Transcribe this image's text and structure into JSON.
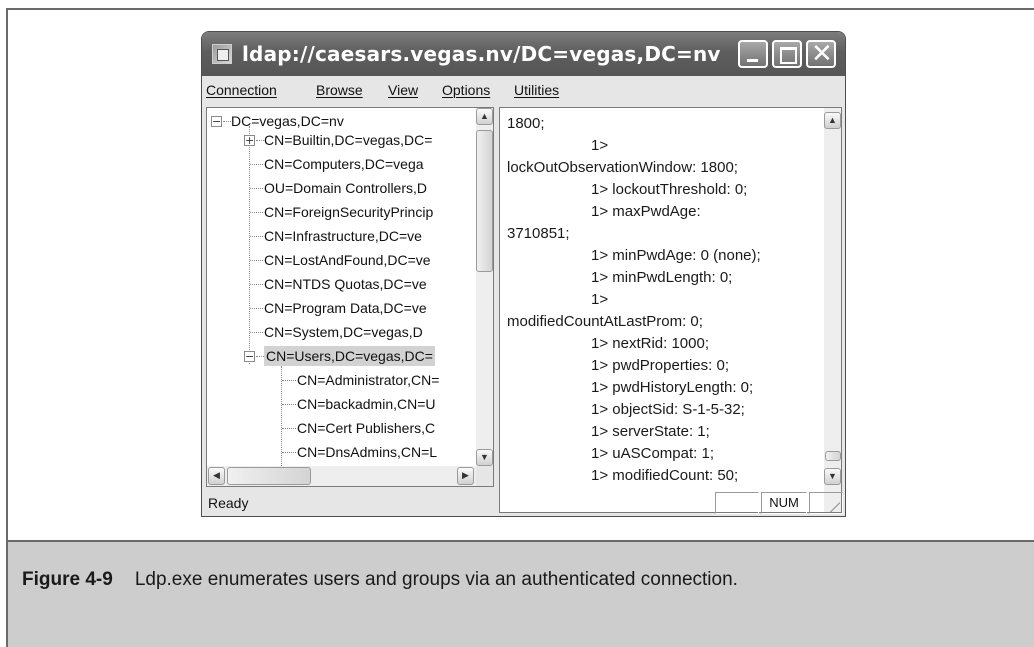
{
  "window": {
    "title": "ldap://caesars.vegas.nv/DC=vegas,DC=nv",
    "menu": [
      "Connection",
      "Browse",
      "View",
      "Options",
      "Utilities"
    ]
  },
  "tree": {
    "root": "DC=vegas,DC=nv",
    "items": [
      {
        "label": "CN=Builtin,DC=vegas,DC=",
        "expander": "+"
      },
      {
        "label": "CN=Computers,DC=vega"
      },
      {
        "label": "OU=Domain Controllers,D"
      },
      {
        "label": "CN=ForeignSecurityPrincip"
      },
      {
        "label": "CN=Infrastructure,DC=ve"
      },
      {
        "label": "CN=LostAndFound,DC=ve"
      },
      {
        "label": "CN=NTDS Quotas,DC=ve"
      },
      {
        "label": "CN=Program Data,DC=ve"
      },
      {
        "label": "CN=System,DC=vegas,D"
      },
      {
        "label": "CN=Users,DC=vegas,DC=",
        "expander": "−",
        "selected": true
      }
    ],
    "children": [
      "CN=Administrator,CN=",
      "CN=backadmin,CN=U",
      "CN=Cert Publishers,C",
      "CN=DnsAdmins,CN=L"
    ]
  },
  "output": [
    "1800;",
    "1>",
    "lockOutObservationWindow: 1800;",
    "1> lockoutThreshold: 0;",
    "1> maxPwdAge:",
    "3710851;",
    "1> minPwdAge: 0 (none);",
    "1> minPwdLength: 0;",
    "1>",
    "modifiedCountAtLastProm: 0;",
    "1> nextRid: 1000;",
    "1> pwdProperties: 0;",
    "1> pwdHistoryLength: 0;",
    "1> objectSid: S-1-5-32;",
    "1> serverState: 1;",
    "1> uASCompat: 1;",
    "1> modifiedCount: 50;"
  ],
  "status": {
    "text": "Ready",
    "num": "NUM"
  },
  "caption": {
    "figure": "Figure 4-9",
    "text": "Ldp.exe enumerates users and groups via an authenticated connection."
  }
}
